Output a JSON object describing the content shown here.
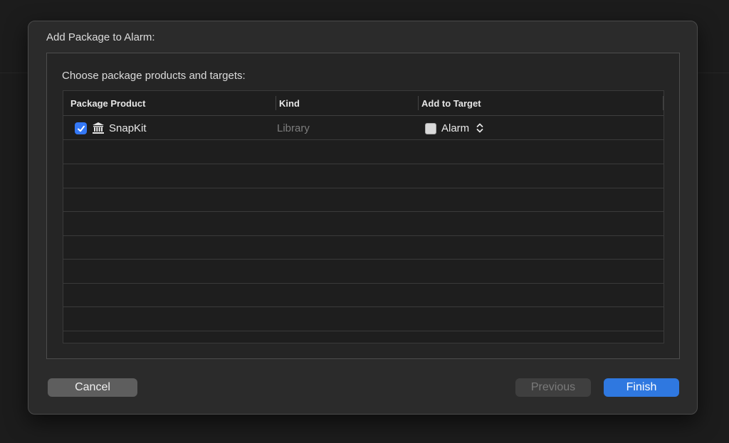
{
  "dialog": {
    "title": "Add Package to Alarm:",
    "heading": "Choose package products and targets:"
  },
  "table": {
    "columns": [
      "Package Product",
      "Kind",
      "Add to Target"
    ],
    "rows": [
      {
        "checked": true,
        "product": "SnapKit",
        "product_icon": "library-building-icon",
        "kind": "Library",
        "target": "Alarm",
        "target_icon": "app-target-icon"
      }
    ]
  },
  "buttons": {
    "cancel": "Cancel",
    "previous": "Previous",
    "finish": "Finish"
  },
  "colors": {
    "accent": "#2f78e0",
    "checkbox": "#3478f6"
  }
}
